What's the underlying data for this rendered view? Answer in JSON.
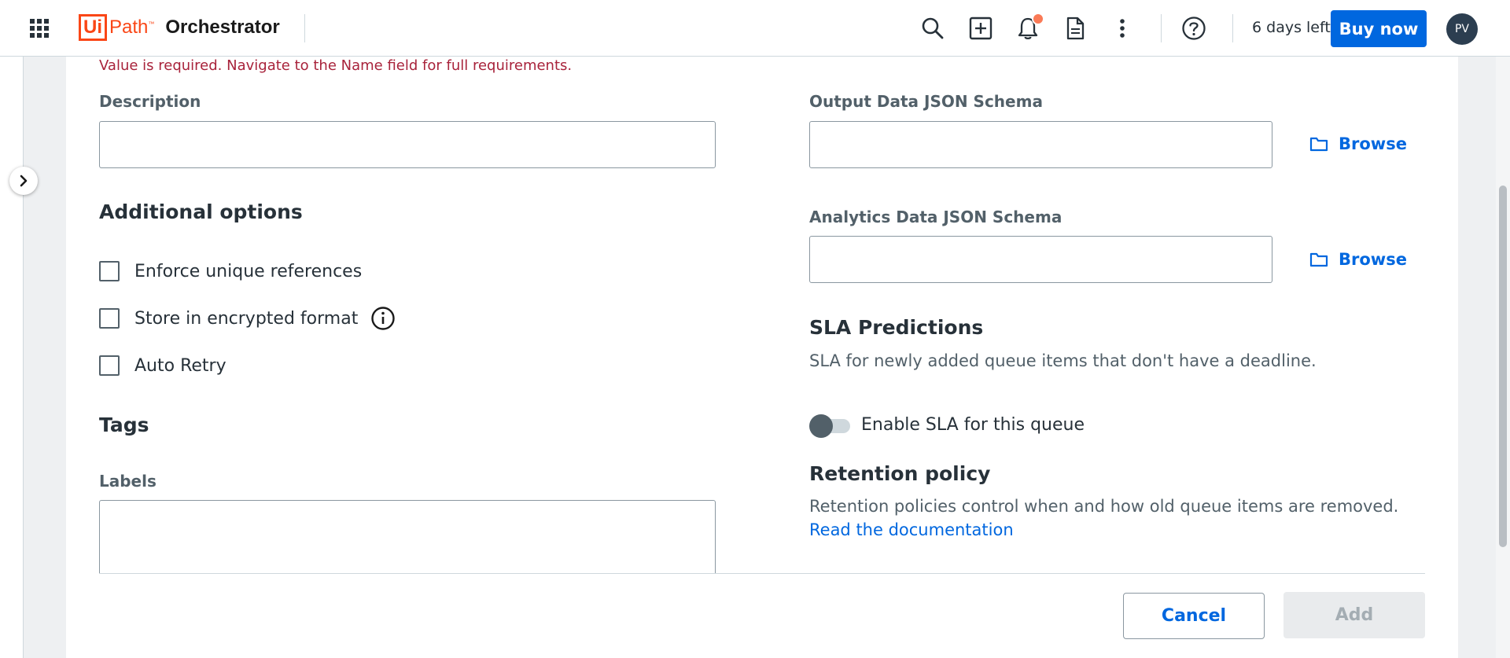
{
  "header": {
    "brand_box": "Ui",
    "brand_path": "Path",
    "brand_tm": "™",
    "product": "Orchestrator",
    "trial_text": "6 days left",
    "buy_label": "Buy now",
    "avatar_initials": "PV",
    "icons": [
      "apps-grid-icon",
      "search-icon",
      "add-box-icon",
      "bell-icon",
      "document-icon",
      "more-vertical-icon",
      "help-icon"
    ],
    "notification_dot_color": "#fa7a56"
  },
  "form": {
    "error_message": "Value is required. Navigate to the Name field for full requirements.",
    "description_label": "Description",
    "description_value": "",
    "additional_options_title": "Additional options",
    "checkboxes": [
      {
        "label": "Enforce unique references",
        "checked": false
      },
      {
        "label": "Store in encrypted format",
        "checked": false
      },
      {
        "label": "Auto Retry",
        "checked": false
      }
    ],
    "tags_title": "Tags",
    "labels_label": "Labels",
    "labels_value": "",
    "output_schema_label": "Output Data JSON Schema",
    "output_schema_value": "",
    "analytics_schema_label": "Analytics Data JSON Schema",
    "analytics_schema_value": "",
    "browse_label": "Browse",
    "sla_title": "SLA Predictions",
    "sla_description": "SLA for newly added queue items that don't have a deadline.",
    "sla_toggle_label": "Enable SLA for this queue",
    "sla_enabled": false,
    "retention_title": "Retention policy",
    "retention_description": "Retention policies control when and how old queue items are removed.",
    "retention_link": "Read the documentation"
  },
  "footer": {
    "cancel_label": "Cancel",
    "add_label": "Add",
    "add_enabled": false
  },
  "colors": {
    "primary": "#0067df",
    "brand": "#fa4616",
    "error": "#a8233b"
  }
}
